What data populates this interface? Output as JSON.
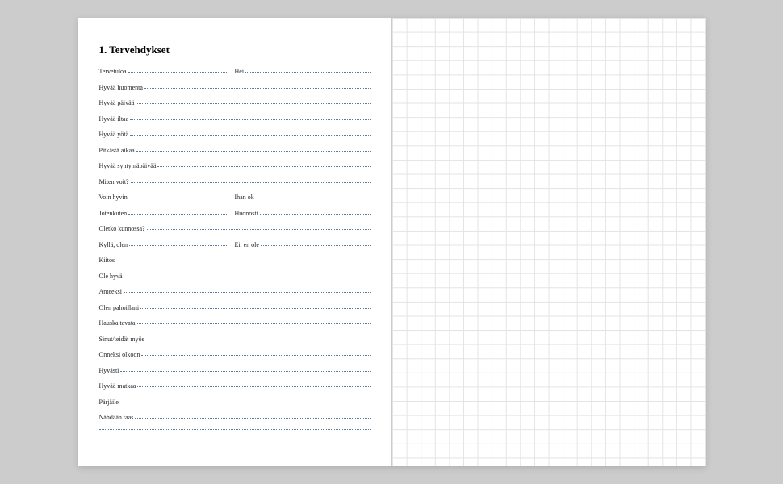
{
  "heading": "1. Tervehdykset",
  "rows": [
    {
      "type": "split",
      "left": "Tervetuloa",
      "right": "Hei"
    },
    {
      "type": "full",
      "text": "Hyvää huomenta"
    },
    {
      "type": "full",
      "text": "Hyvää päivää"
    },
    {
      "type": "full",
      "text": "Hyvää iltaa"
    },
    {
      "type": "full",
      "text": "Hyvää yötä"
    },
    {
      "type": "full",
      "text": "Pitkästä aikaa"
    },
    {
      "type": "full",
      "text": "Hyvää syntymäpäivää"
    },
    {
      "type": "full",
      "text": "Miten voit?"
    },
    {
      "type": "split",
      "left": "Voin hyvin",
      "right": "Ihan ok"
    },
    {
      "type": "split",
      "left": "Jotenkuten",
      "right": "Huonosti"
    },
    {
      "type": "full",
      "text": "Oletko kunnossa?"
    },
    {
      "type": "split",
      "left": "Kyllä, olen",
      "right": "Ei, en ole"
    },
    {
      "type": "full",
      "text": "Kiitos"
    },
    {
      "type": "full",
      "text": "Ole hyvä"
    },
    {
      "type": "full",
      "text": "Anteeksi"
    },
    {
      "type": "full",
      "text": "Olen pahoillani"
    },
    {
      "type": "full",
      "text": "Hauska tavata"
    },
    {
      "type": "full",
      "text": "Sinut/teidät myös"
    },
    {
      "type": "full",
      "text": "Onneksi olkoon"
    },
    {
      "type": "full",
      "text": "Hyvästi"
    },
    {
      "type": "full",
      "text": "Hyvää matkaa"
    },
    {
      "type": "full",
      "text": "Pärjäile"
    },
    {
      "type": "full",
      "text": "Nähdään taas"
    },
    {
      "type": "blank"
    }
  ]
}
